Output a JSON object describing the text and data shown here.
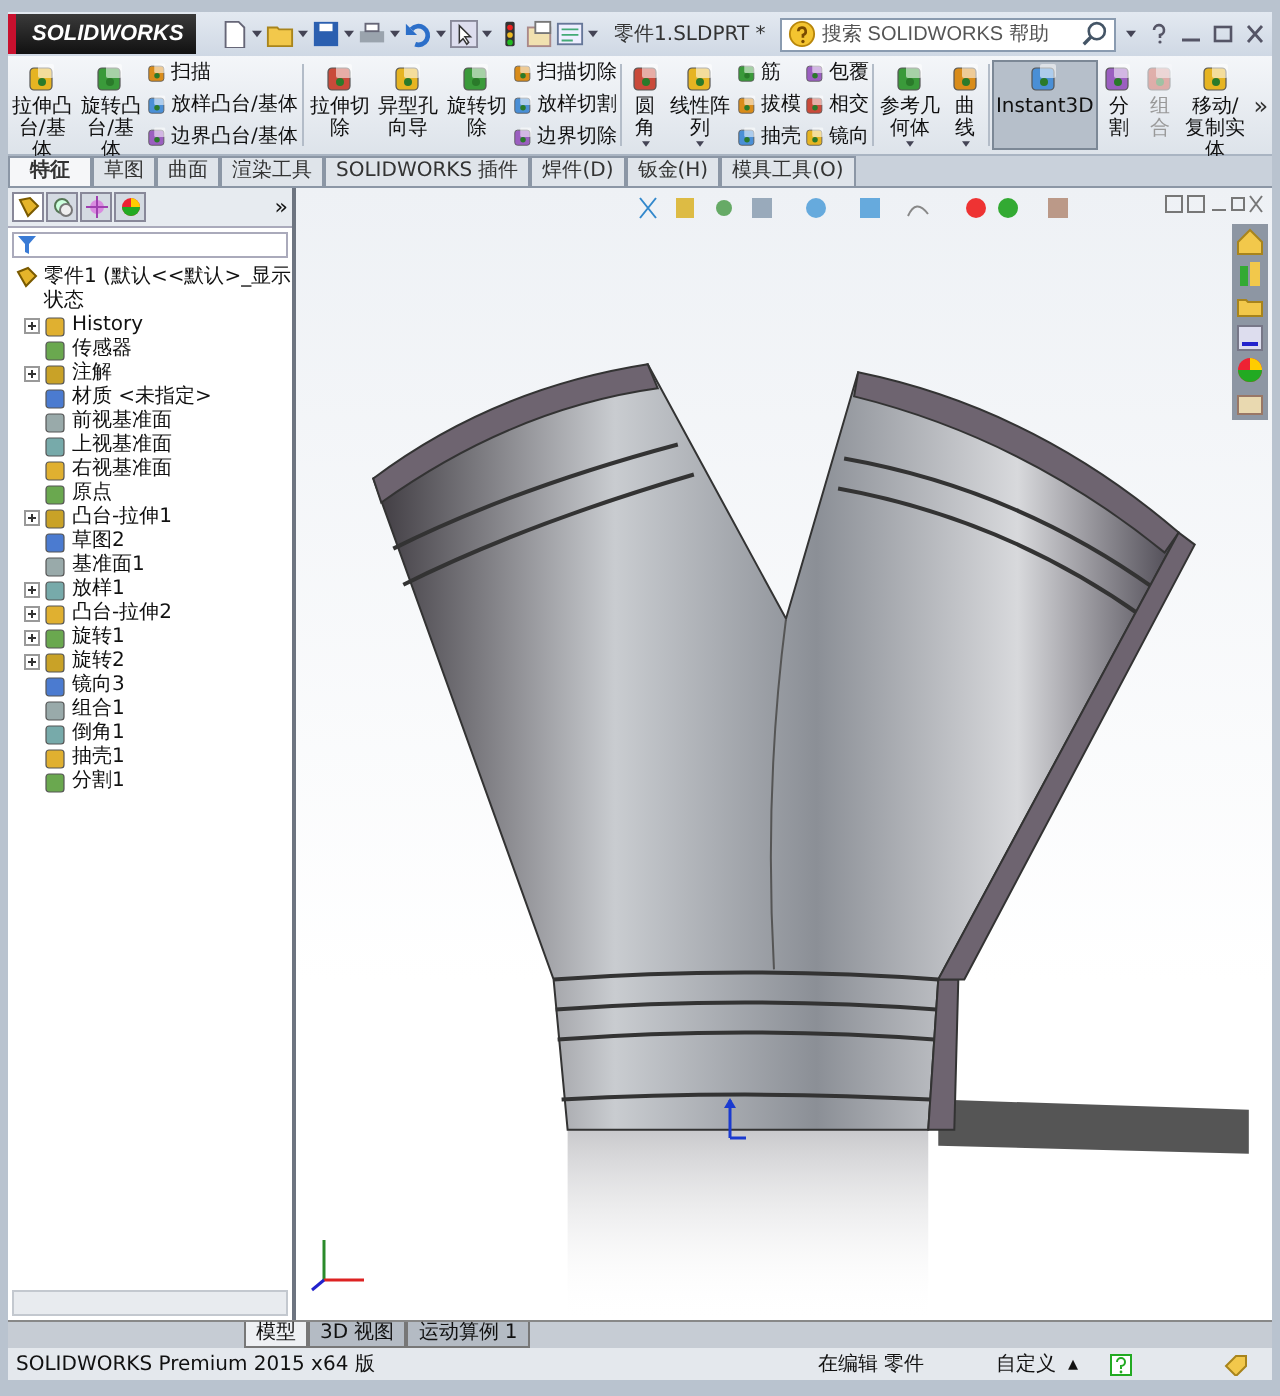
{
  "app": {
    "logo": "SOLIDWORKS",
    "title": "零件1.SLDPRT *",
    "search": {
      "placeholder": "搜索 SOLIDWORKS 帮助"
    }
  },
  "ribbon": [
    {
      "kind": "large",
      "label": "拉伸凸台/基体"
    },
    {
      "kind": "large",
      "label": "旋转凸台/基体"
    },
    {
      "kind": "stack",
      "items": [
        {
          "label": "扫描"
        },
        {
          "label": "放样凸台/基体"
        },
        {
          "label": "边界凸台/基体"
        }
      ]
    },
    {
      "kind": "separator"
    },
    {
      "kind": "large",
      "label": "拉伸切除"
    },
    {
      "kind": "large",
      "label": "异型孔向导"
    },
    {
      "kind": "large",
      "label": "旋转切除"
    },
    {
      "kind": "stack",
      "items": [
        {
          "label": "扫描切除"
        },
        {
          "label": "放样切割"
        },
        {
          "label": "边界切除"
        }
      ]
    },
    {
      "kind": "separator"
    },
    {
      "kind": "large",
      "label": "圆角",
      "dropdown": true
    },
    {
      "kind": "large",
      "label": "线性阵列",
      "dropdown": true
    },
    {
      "kind": "stack",
      "items": [
        {
          "label": "筋"
        },
        {
          "label": "拔模"
        },
        {
          "label": "抽壳"
        }
      ]
    },
    {
      "kind": "stack",
      "items": [
        {
          "label": "包覆"
        },
        {
          "label": "相交"
        },
        {
          "label": "镜向"
        }
      ]
    },
    {
      "kind": "separator"
    },
    {
      "kind": "large",
      "label": "参考几何体",
      "dropdown": true
    },
    {
      "kind": "large",
      "label": "曲线",
      "dropdown": true
    },
    {
      "kind": "separator"
    },
    {
      "kind": "large",
      "label": "Instant3D",
      "selected": true
    },
    {
      "kind": "large",
      "label": "分割"
    },
    {
      "kind": "large",
      "label": "组合",
      "disabled": true
    },
    {
      "kind": "large",
      "label": "移动/复制实体"
    },
    {
      "kind": "more",
      "label": "»"
    }
  ],
  "tabs": [
    {
      "label": "特征",
      "selected": true
    },
    {
      "label": "草图",
      "selected": false
    },
    {
      "label": "曲面",
      "selected": false
    },
    {
      "label": "渲染工具",
      "selected": false
    },
    {
      "label": "SOLIDWORKS 插件",
      "selected": false
    },
    {
      "label": "焊件(D)",
      "selected": false
    },
    {
      "label": "钣金(H)",
      "selected": false
    },
    {
      "label": "模具工具(O)",
      "selected": false
    }
  ],
  "panel": {
    "tabs": [
      {
        "selected": true
      },
      {
        "selected": false
      },
      {
        "selected": false
      },
      {
        "selected": false
      }
    ],
    "more": "»",
    "tree": {
      "label": "零件1  (默认<<默认>_显示状态",
      "children": [
        {
          "label": "History",
          "expanded": false
        },
        {
          "label": "传感器"
        },
        {
          "label": "注解",
          "expanded": false
        },
        {
          "label": "材质 <未指定>"
        },
        {
          "label": "前视基准面"
        },
        {
          "label": "上视基准面"
        },
        {
          "label": "右视基准面"
        },
        {
          "label": "原点"
        },
        {
          "label": "凸台-拉伸1",
          "expanded": false
        },
        {
          "label": "草图2"
        },
        {
          "label": "基准面1"
        },
        {
          "label": "放样1",
          "expanded": false
        },
        {
          "label": "凸台-拉伸2",
          "expanded": false
        },
        {
          "label": "旋转1",
          "expanded": false
        },
        {
          "label": "旋转2",
          "expanded": false
        },
        {
          "label": "镜向3"
        },
        {
          "label": "组合1"
        },
        {
          "label": "倒角1"
        },
        {
          "label": "抽壳1"
        },
        {
          "label": "分割1"
        }
      ]
    }
  },
  "bottom_tabs": [
    {
      "label": "模型",
      "selected": true
    },
    {
      "label": "3D 视图",
      "selected": false
    },
    {
      "label": "运动算例 1",
      "selected": false
    }
  ],
  "status_bar": {
    "product": "SOLIDWORKS Premium 2015 x64 版",
    "mode": "在编辑 零件",
    "units": "自定义",
    "units_caret": "▴"
  }
}
